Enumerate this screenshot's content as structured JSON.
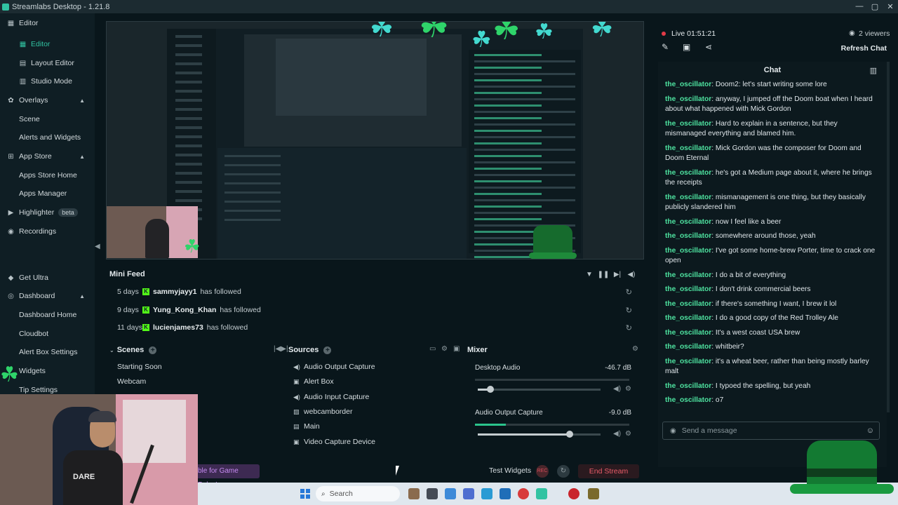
{
  "window": {
    "title": "Streamlabs Desktop - 1.21.8",
    "controls": [
      "—",
      "▢",
      "✕"
    ]
  },
  "sidebar": {
    "items": [
      {
        "label": "Editor",
        "kind": "header",
        "icon": "grid-icon",
        "expanded": true
      },
      {
        "label": "Editor",
        "kind": "sub",
        "icon": "grid-icon",
        "active": true
      },
      {
        "label": "Layout Editor",
        "kind": "sub",
        "icon": "layout-icon"
      },
      {
        "label": "Studio Mode",
        "kind": "sub",
        "icon": "studio-icon"
      },
      {
        "label": "Overlays",
        "kind": "top",
        "icon": "overlays-icon",
        "expanded": true
      },
      {
        "label": "Scene",
        "kind": "sub"
      },
      {
        "label": "Alerts and Widgets",
        "kind": "sub"
      },
      {
        "label": "App Store",
        "kind": "top",
        "icon": "store-icon",
        "expanded": true
      },
      {
        "label": "Apps Store Home",
        "kind": "sub"
      },
      {
        "label": "Apps Manager",
        "kind": "sub"
      },
      {
        "label": "Highlighter",
        "kind": "top",
        "icon": "highlighter-icon",
        "badge": "beta"
      },
      {
        "label": "Recordings",
        "kind": "top",
        "icon": "record-icon"
      },
      {
        "label": "Get Ultra",
        "kind": "top",
        "icon": "ultra-icon"
      },
      {
        "label": "Dashboard",
        "kind": "top",
        "icon": "dashboard-icon",
        "expanded": true
      },
      {
        "label": "Dashboard Home",
        "kind": "sub"
      },
      {
        "label": "Cloudbot",
        "kind": "sub"
      },
      {
        "label": "Alert Box Settings",
        "kind": "sub"
      },
      {
        "label": "Widgets",
        "kind": "sub"
      },
      {
        "label": "Tip Settings",
        "kind": "sub"
      }
    ]
  },
  "minifeed": {
    "title": "Mini Feed",
    "controls": [
      "filter-icon",
      "pause-icon",
      "skip-icon",
      "volume-icon"
    ],
    "events": [
      {
        "time": "5 days",
        "user": "sammyjayy1",
        "action": "has followed"
      },
      {
        "time": "9 days",
        "user": "Yung_Kong_Khan",
        "action": "has followed"
      },
      {
        "time": "11 days",
        "user": "lucienjames73",
        "action": "has followed"
      }
    ]
  },
  "scenes": {
    "title": "Scenes",
    "items": [
      "Starting Soon",
      "Webcam"
    ]
  },
  "sources": {
    "title": "Sources",
    "items": [
      {
        "label": "Audio Output Capture",
        "icon": "speaker-icon"
      },
      {
        "label": "Alert Box",
        "icon": "alert-box-icon"
      },
      {
        "label": "Audio Input Capture",
        "icon": "microphone-icon"
      },
      {
        "label": "webcamborder",
        "icon": "image-icon"
      },
      {
        "label": "Main",
        "icon": "file-icon"
      },
      {
        "label": "Video Capture Device",
        "icon": "camera-icon"
      }
    ]
  },
  "mixer": {
    "title": "Mixer",
    "channels": [
      {
        "name": "Desktop Audio",
        "db": "-46.7 dB",
        "volume": 0.1,
        "level": 0.0
      },
      {
        "name": "Audio Output Capture",
        "db": "-9.0 dB",
        "volume": 0.75,
        "level": 0.2
      }
    ]
  },
  "footer": {
    "game_pulse": "ble for Game Pulse!",
    "test_widgets": "Test Widgets",
    "rec_label": "REC",
    "end_stream": "End Stream"
  },
  "chat": {
    "live": "Live 01:51:21",
    "viewers": "2 viewers",
    "refresh": "Refresh Chat",
    "title": "Chat",
    "placeholder": "Send a message",
    "messages": [
      {
        "user": "the_oscillator",
        "text": "Doom2: let's start writing some lore"
      },
      {
        "user": "the_oscillator",
        "text": "anyway, I jumped off the Doom boat when I heard about what happened with Mick Gordon"
      },
      {
        "user": "the_oscillator",
        "text": "Hard to explain in a sentence, but they mismanaged everything and blamed him."
      },
      {
        "user": "the_oscillator",
        "text": "Mick Gordon was the composer for Doom and Doom Eternal"
      },
      {
        "user": "the_oscillator",
        "text": "he's got a Medium page about it, where he brings the receipts"
      },
      {
        "user": "the_oscillator",
        "text": "mismanagement is one thing, but they basically publicly slandered him"
      },
      {
        "user": "the_oscillator",
        "text": "now I feel like a beer"
      },
      {
        "user": "the_oscillator",
        "text": "somewhere around those, yeah"
      },
      {
        "user": "the_oscillator",
        "text": "I've got some home-brew Porter, time to crack one open"
      },
      {
        "user": "the_oscillator",
        "text": "I do a bit of everything"
      },
      {
        "user": "the_oscillator",
        "text": "I don't drink commercial beers"
      },
      {
        "user": "the_oscillator",
        "text": "if there's something I want, I brew it lol"
      },
      {
        "user": "the_oscillator",
        "text": "I do a good copy of the Red Trolley Ale"
      },
      {
        "user": "the_oscillator",
        "text": "It's a west coast USA brew"
      },
      {
        "user": "the_oscillator",
        "text": "whitbeir?"
      },
      {
        "user": "the_oscillator",
        "text": "it's a wheat beer, rather than being mostly barley malt"
      },
      {
        "user": "the_oscillator",
        "text": "I typoed the spelling, but yeah"
      },
      {
        "user": "the_oscillator",
        "text": "o7"
      }
    ]
  },
  "webcam": {
    "shirt_text": "DARE"
  },
  "taskbar": {
    "search_label": "Search"
  },
  "colors": {
    "accent": "#31c3a2",
    "chat_user": "#4ee3a0",
    "danger": "#ea5c69",
    "kick_green": "#53fc18"
  }
}
